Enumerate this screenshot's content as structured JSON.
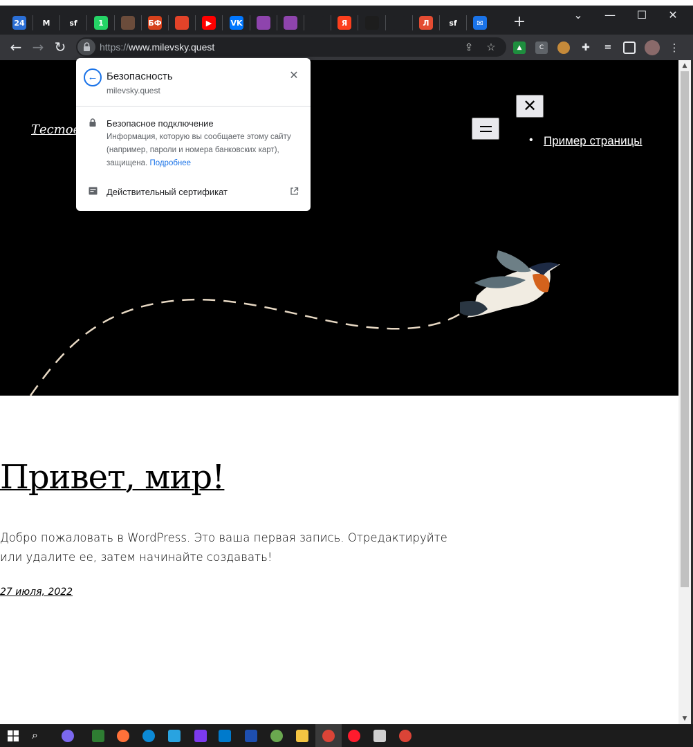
{
  "browser": {
    "tabs": [
      {
        "name": "tab-24",
        "label": "24",
        "color": "#2b6fd6"
      },
      {
        "name": "tab-gmail",
        "label": "M",
        "color": "#202124"
      },
      {
        "name": "tab-symfony-1",
        "label": "sf",
        "color": "#202124"
      },
      {
        "name": "tab-whatsapp",
        "label": "1",
        "color": "#25d366"
      },
      {
        "name": "tab-photo",
        "label": "",
        "color": "#6b4c3b"
      },
      {
        "name": "tab-bf",
        "label": "БФ",
        "color": "#d6411c"
      },
      {
        "name": "tab-gitlab",
        "label": "",
        "color": "#e24329"
      },
      {
        "name": "tab-youtube",
        "label": "▶",
        "color": "#ff0000"
      },
      {
        "name": "tab-vk",
        "label": "VK",
        "color": "#0077ff"
      },
      {
        "name": "tab-app-1",
        "label": "",
        "color": "#8e44ad"
      },
      {
        "name": "tab-app-2",
        "label": "",
        "color": "#8e44ad"
      },
      {
        "name": "tab-github",
        "label": "",
        "color": "#202124"
      },
      {
        "name": "tab-yandex",
        "label": "Я",
        "color": "#fc3f1d"
      },
      {
        "name": "tab-app-3",
        "label": "",
        "color": "#1d1d1d"
      },
      {
        "name": "tab-globe",
        "label": "",
        "color": "#202124"
      },
      {
        "name": "tab-l",
        "label": "Л",
        "color": "#e44c32"
      },
      {
        "name": "tab-symfony-2",
        "label": "sf",
        "color": "#202124"
      },
      {
        "name": "tab-mail",
        "label": "✉",
        "color": "#1a73e8"
      }
    ],
    "new_tab_label": "+",
    "url_scheme": "https://",
    "url_host": "www.milevsky.quest"
  },
  "site": {
    "title": "Тестовы",
    "nav_item": "Пример страницы",
    "close_symbol": "✕"
  },
  "post": {
    "title": "Привет, мир!",
    "body": "Добро пожаловать в WordPress. Это ваша первая запись. Отредактируйте или удалите ее, затем начинайте создавать!",
    "date": "27 июля, 2022"
  },
  "security_popup": {
    "title": "Безопасность",
    "host": "milevsky.quest",
    "connection_title": "Безопасное подключение",
    "connection_desc": "Информация, которую вы сообщаете этому сайту (например, пароли и номера банковских карт), защищена.",
    "more_link": "Подробнее",
    "certificate_label": "Действительный сертификат"
  },
  "colors": {
    "accent": "#1a73e8",
    "hero_bg": "#000000",
    "chrome_dark": "#202124"
  }
}
